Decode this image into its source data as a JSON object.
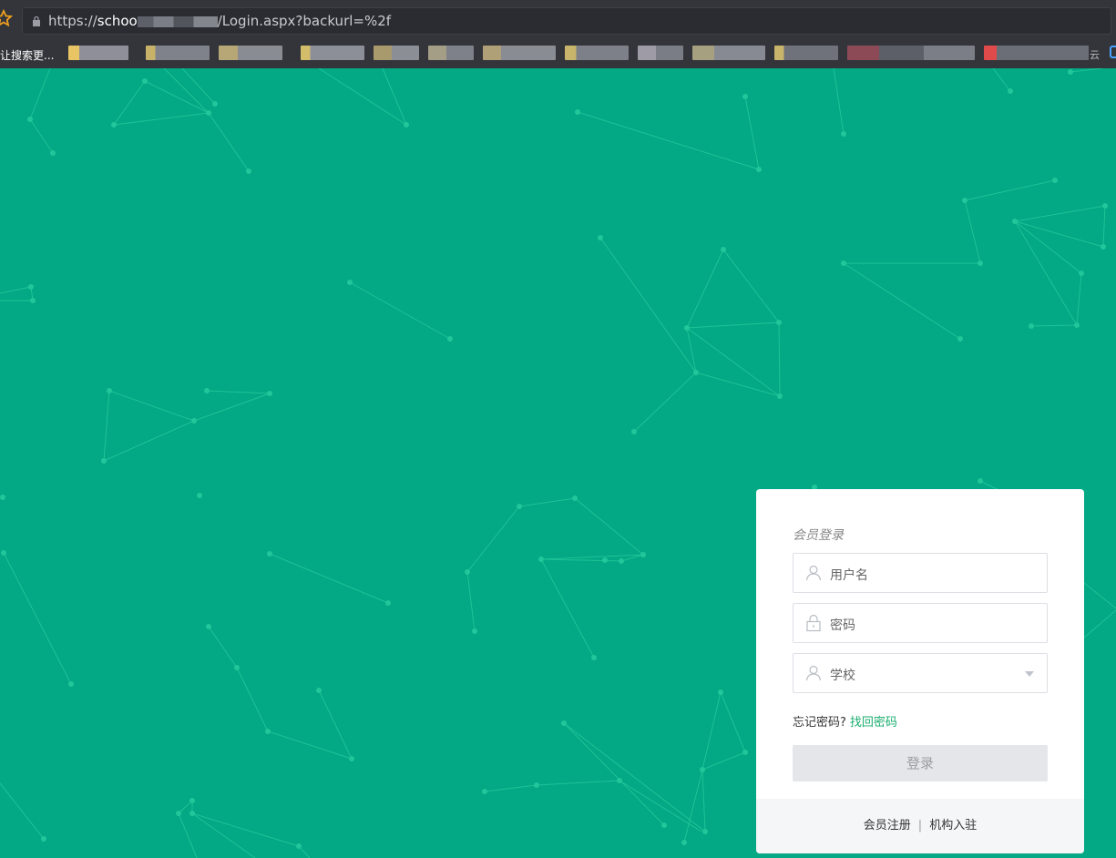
{
  "browser": {
    "url_prefix": "https://",
    "url_host": "schoo",
    "url_path": "/Login.aspx?backurl=%2f",
    "bookmark_first": "让搜索更...",
    "bookmark_last": "云",
    "bookmark_colors": [
      "#e8c464",
      "#8f8f9a",
      "#b7a777",
      "#c8b26a",
      "#a89a6c",
      "#a49e86",
      "#b0a077",
      "#c9b46c",
      "#9e9aa6",
      "#a69f80",
      "#c8b46a",
      "#8c4a57",
      "#e04a4a"
    ]
  },
  "login": {
    "title": "会员登录",
    "username_placeholder": "用户名",
    "password_placeholder": "密码",
    "school_placeholder": "学校",
    "forgot_text": "忘记密码?",
    "forgot_link": "找回密码",
    "submit_label": "登录",
    "register_label": "会员注册",
    "divider": "|",
    "institution_label": "机构入驻"
  },
  "colors": {
    "background": "#03a884",
    "network": "#21c79a",
    "link": "#1aad6e"
  },
  "icons": {
    "username": "user-icon",
    "password": "lock-icon",
    "school": "user-icon",
    "school_dropdown": "chevron-down-icon"
  }
}
